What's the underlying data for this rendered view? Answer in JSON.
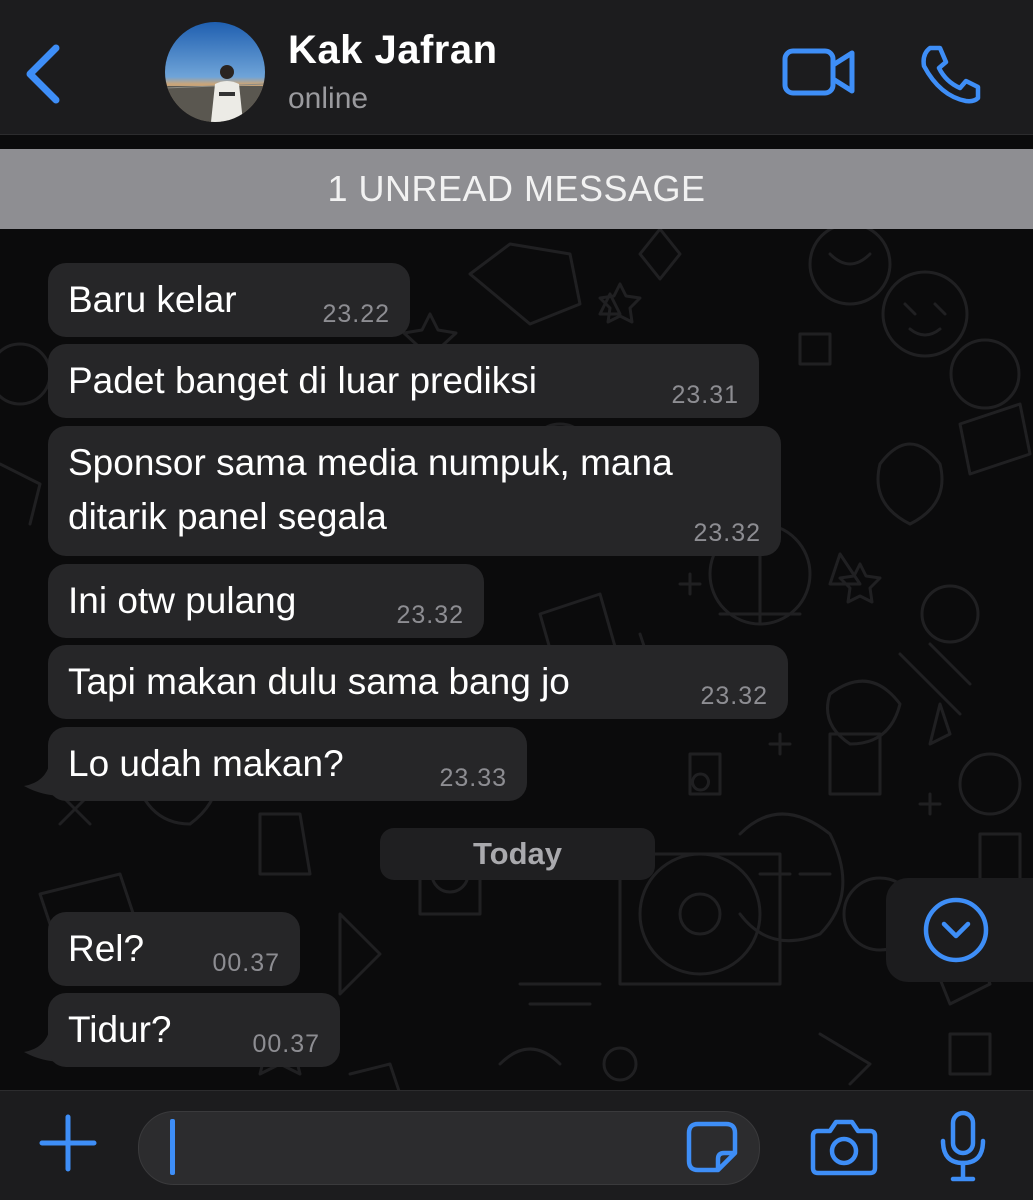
{
  "colors": {
    "accent": "#3e8ef7",
    "header_bg": "#1c1c1e",
    "bubble_bg": "#262628",
    "banner_bg": "#8e8e92",
    "time_text": "#8d8d92"
  },
  "header": {
    "back_icon": "chevron-left-icon",
    "contact_name": "Kak Jafran",
    "status": "online",
    "video_icon": "video-camera-icon",
    "call_icon": "phone-icon"
  },
  "banner": {
    "unread_label": "1 UNREAD MESSAGE"
  },
  "messages_yesterday": [
    {
      "text_lines": [
        "Baru kelar"
      ],
      "time": "23.22"
    },
    {
      "text_lines": [
        "Padet banget di luar prediksi"
      ],
      "time": "23.31"
    },
    {
      "text_lines": [
        "Sponsor sama media numpuk, mana",
        "ditarik panel segala"
      ],
      "time": "23.32"
    },
    {
      "text_lines": [
        "Ini otw pulang"
      ],
      "time": "23.32"
    },
    {
      "text_lines": [
        "Tapi makan dulu sama bang jo"
      ],
      "time": "23.32"
    },
    {
      "text_lines": [
        "Lo udah makan?"
      ],
      "time": "23.33"
    }
  ],
  "date_separator": "Today",
  "messages_today": [
    {
      "text_lines": [
        "Rel?"
      ],
      "time": "00.37"
    },
    {
      "text_lines": [
        "Tidur?"
      ],
      "time": "00.37"
    }
  ],
  "scroll_down_icon": "chevron-down-circle-icon",
  "composer": {
    "plus_icon": "plus-icon",
    "input_value": "",
    "sticker_icon": "sticker-icon",
    "camera_icon": "camera-icon",
    "mic_icon": "microphone-icon"
  }
}
